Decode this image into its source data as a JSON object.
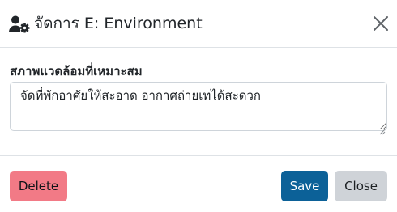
{
  "modal": {
    "title": "จัดการ E: Environment",
    "header_icon": "user-gear-icon",
    "close_icon": "close-icon"
  },
  "form": {
    "label": "สภาพแวดล้อมที่เหมาะสม",
    "value": "จัดที่พักอาศัยให้สะอาด อากาศถ่ายเทได้สะดวก"
  },
  "footer": {
    "delete_label": "Delete",
    "save_label": "Save",
    "close_label": "Close"
  },
  "colors": {
    "delete_bg": "#f27a86",
    "save_bg": "#0c6198",
    "close_bg": "#cfd3d8",
    "text": "#212529",
    "border": "#dee2e6"
  }
}
